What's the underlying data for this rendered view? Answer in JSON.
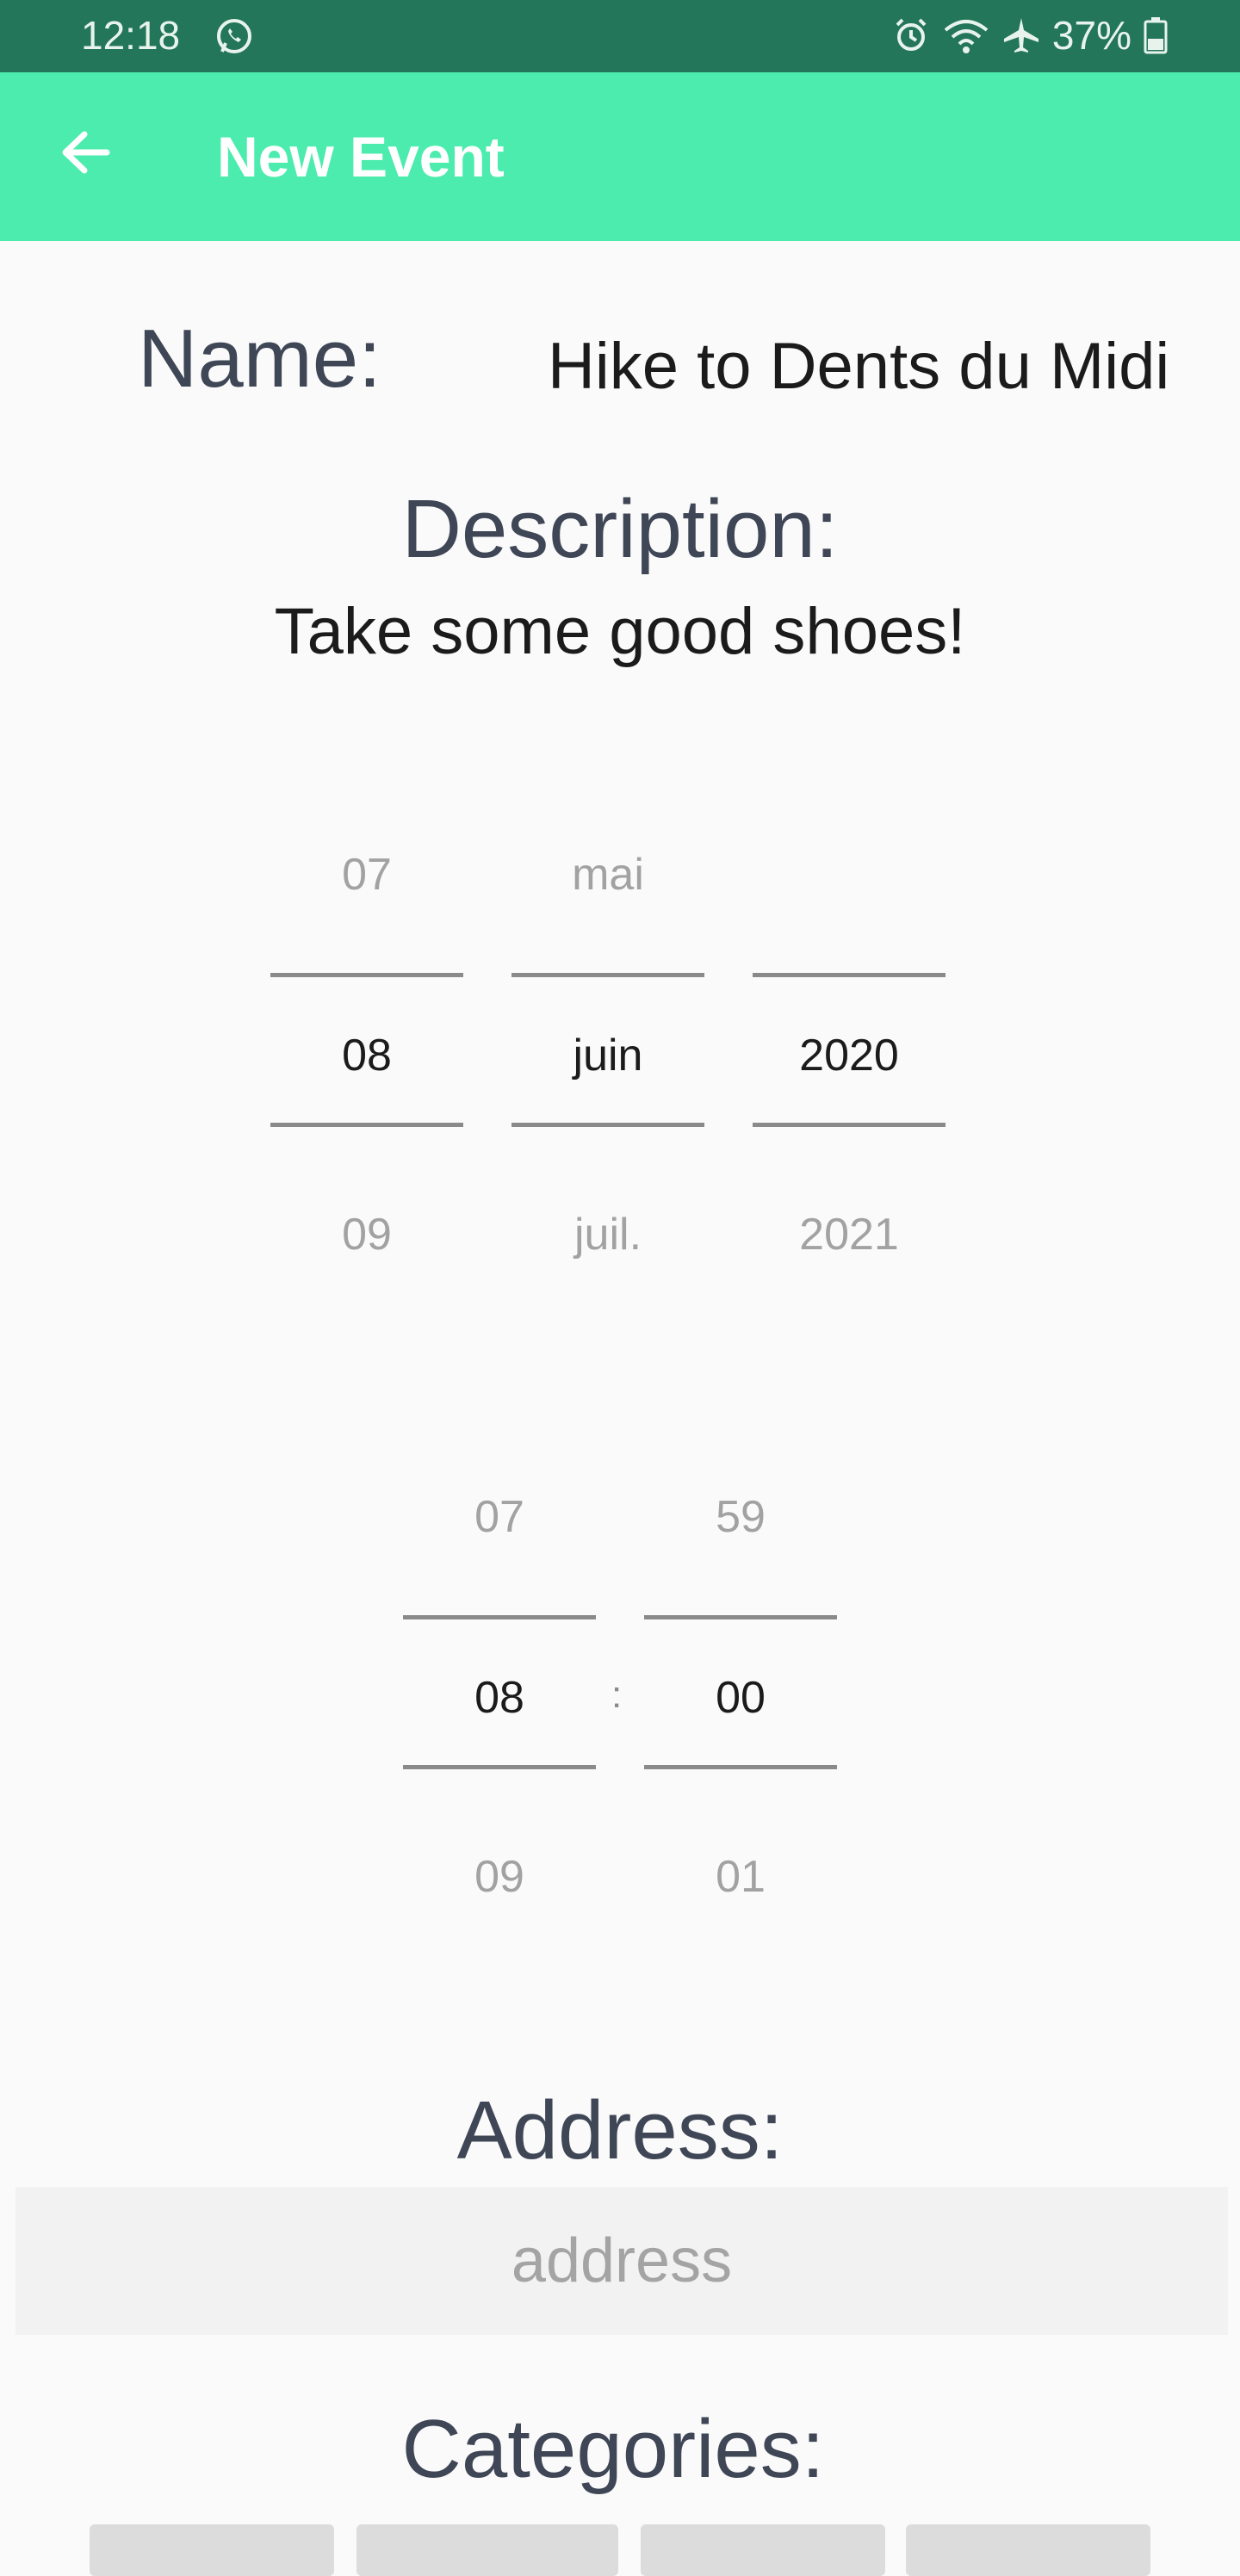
{
  "status_bar": {
    "time": "12:18",
    "battery": "37%"
  },
  "app_bar": {
    "title": "New Event"
  },
  "form": {
    "name_label": "Name:",
    "name_value": "Hike to Dents du Midi",
    "description_label": "Description:",
    "description_value": "Take some good shoes!",
    "date_picker": {
      "day": {
        "prev": "07",
        "selected": "08",
        "next": "09"
      },
      "month": {
        "prev": "mai",
        "selected": "juin",
        "next": "juil."
      },
      "year": {
        "prev": "",
        "selected": "2020",
        "next": "2021"
      }
    },
    "time_picker": {
      "hour": {
        "prev": "07",
        "selected": "08",
        "next": "09"
      },
      "separator": ":",
      "minute": {
        "prev": "59",
        "selected": "00",
        "next": "01"
      }
    },
    "address_label": "Address:",
    "address_placeholder": "address",
    "categories_label": "Categories:"
  },
  "colors": {
    "status_bar": "#23765a",
    "app_bar": "#4cecae",
    "label": "#3f4656"
  }
}
